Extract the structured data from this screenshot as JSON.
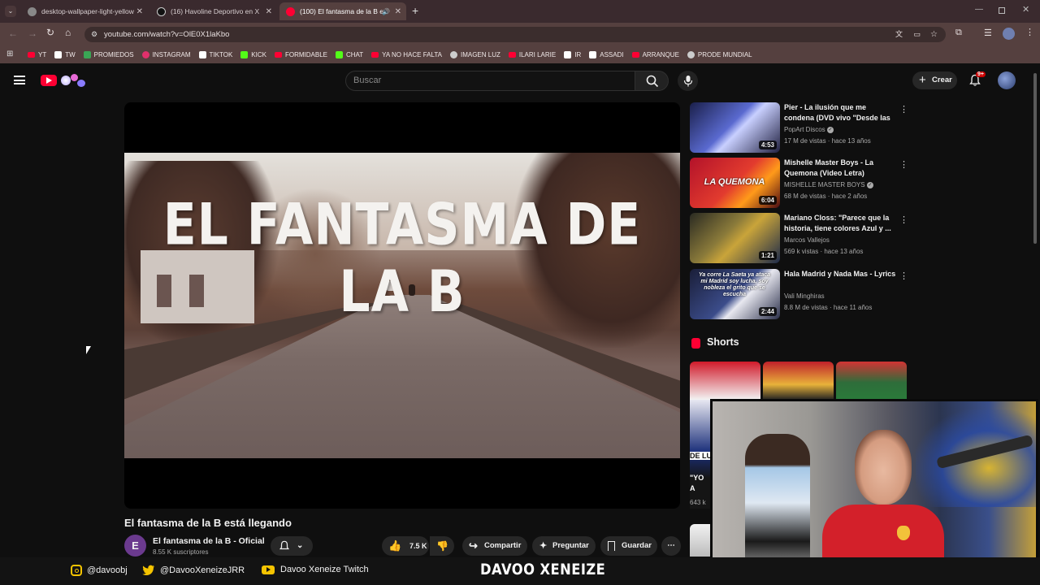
{
  "browser": {
    "tabs": [
      {
        "label": "desktop-wallpaper-light-yellow",
        "active": false
      },
      {
        "label": "(16) Havoline Deportivo en X",
        "active": false
      },
      {
        "label": "(100) El fantasma de la B e",
        "active": true
      }
    ],
    "url": "youtube.com/watch?v=OlE0X1laKbo",
    "bookmarks": [
      {
        "label": "YT",
        "icon": "youtube-icon",
        "color": "#ff0033"
      },
      {
        "label": "TW",
        "icon": "x-icon",
        "color": "#ffffff"
      },
      {
        "label": "PROMIEDOS",
        "icon": "promiedos-icon",
        "color": "#3aa655"
      },
      {
        "label": "INSTAGRAM",
        "icon": "instagram-icon",
        "color": "#e1306c"
      },
      {
        "label": "TIKTOK",
        "icon": "tiktok-icon",
        "color": "#ffffff"
      },
      {
        "label": "KICK",
        "icon": "kick-icon",
        "color": "#53fc18"
      },
      {
        "label": "FORMIDABLE",
        "icon": "youtube-icon",
        "color": "#ff0033"
      },
      {
        "label": "CHAT",
        "icon": "kick-icon",
        "color": "#53fc18"
      },
      {
        "label": "YA NO HACE FALTA",
        "icon": "youtube-icon",
        "color": "#ff0033"
      },
      {
        "label": "IMAGEN LUZ",
        "icon": "globe-icon",
        "color": "#cccccc"
      },
      {
        "label": "ILARI LARIE",
        "icon": "youtube-icon",
        "color": "#ff0033"
      },
      {
        "label": "IR",
        "icon": "mk-icon",
        "color": "#ffffff"
      },
      {
        "label": "ASSADI",
        "icon": "x-icon",
        "color": "#ffffff"
      },
      {
        "label": "ARRANQUE",
        "icon": "youtube-icon",
        "color": "#ff0033"
      },
      {
        "label": "PRODE MUNDIAL",
        "icon": "globe-icon",
        "color": "#cccccc"
      }
    ]
  },
  "youtube": {
    "search_placeholder": "Buscar",
    "create_label": "Crear",
    "notifications_badge": "9+",
    "video": {
      "overlay_text": "EL FANTASMA DE LA B",
      "title": "El fantasma de la B está llegando",
      "channel": "El fantasma de la B - Oficial",
      "channel_initial": "E",
      "subscribers": "8.55 K suscriptores",
      "likes": "7.5 K",
      "share_label": "Compartir",
      "ask_label": "Preguntar",
      "save_label": "Guardar"
    },
    "recommendations": [
      {
        "title": "Pier - La ilusión que me condena (DVD vivo \"Desde las ...",
        "channel": "PopArt Discos",
        "verified": true,
        "meta": "17 M de vistas · hace 13 años",
        "duration": "4:53",
        "thumb": "linear-gradient(135deg,#1a1f4a,#5a6ad0 45%,#c9d0ff 55%,#202040)"
      },
      {
        "title": "Mishelle Master Boys - La Quemona (Video Letra)",
        "channel": "MISHELLE MASTER BOYS",
        "verified": true,
        "meta": "68 M de vistas · hace 2 años",
        "duration": "6:04",
        "thumb": "linear-gradient(135deg,#b3122a,#e23b2e 50%,#ff9a1a 70%,#4a0a12)",
        "thumb_text": "LA QUEMONA"
      },
      {
        "title": "Mariano Closs: \"Parece que la historia, tiene colores Azul y ...",
        "channel": "Marcos Vallejos",
        "verified": false,
        "meta": "569 k vistas · hace 13 años",
        "duration": "1:21",
        "thumb": "linear-gradient(135deg,#2a2a22,#8a7a3a 40%,#c9a43a 55%,#1d2a4a)"
      },
      {
        "title": "Hala Madrid y Nada Mas - Lyrics",
        "channel": "Vali Minghiras",
        "verified": false,
        "meta": "8.8 M de vistas · hace 11 años",
        "duration": "2:44",
        "thumb": "linear-gradient(135deg,#1a1e38,#3b4c8a 50%,#e8e8f0 60%,#2a2f4a)",
        "thumb_text": "Ya corre La Saeta ya ataca mi Madrid soy lucha, soy nobleza el grito que se escucha"
      }
    ],
    "shorts_title": "Shorts",
    "shorts": [
      {
        "bg": "linear-gradient(180deg,#d01a2a,#f3f3f3)",
        "caption": "\"YO A JUAN",
        "views": "643 k",
        "label": "DE LUJ"
      },
      {
        "bg": "linear-gradient(180deg,#c0202a,#e8b23a 60%,#222)"
      },
      {
        "bg": "linear-gradient(180deg,#d23434,#2e6d3a 55%,#2a7a3a)"
      }
    ]
  },
  "stream_overlay": {
    "socials": [
      {
        "handle": "@davoobj",
        "icon": "instagram-icon"
      },
      {
        "handle": "@DavooXeneizeJRR",
        "icon": "twitter-icon"
      },
      {
        "handle": "Davoo Xeneize Twitch",
        "icon": "youtube-icon"
      }
    ],
    "streamer_name": "DAVOO XENEIZE",
    "colors": {
      "instagram": "#f5c400",
      "twitter": "#f5c400",
      "youtube": "#f5c400"
    }
  }
}
